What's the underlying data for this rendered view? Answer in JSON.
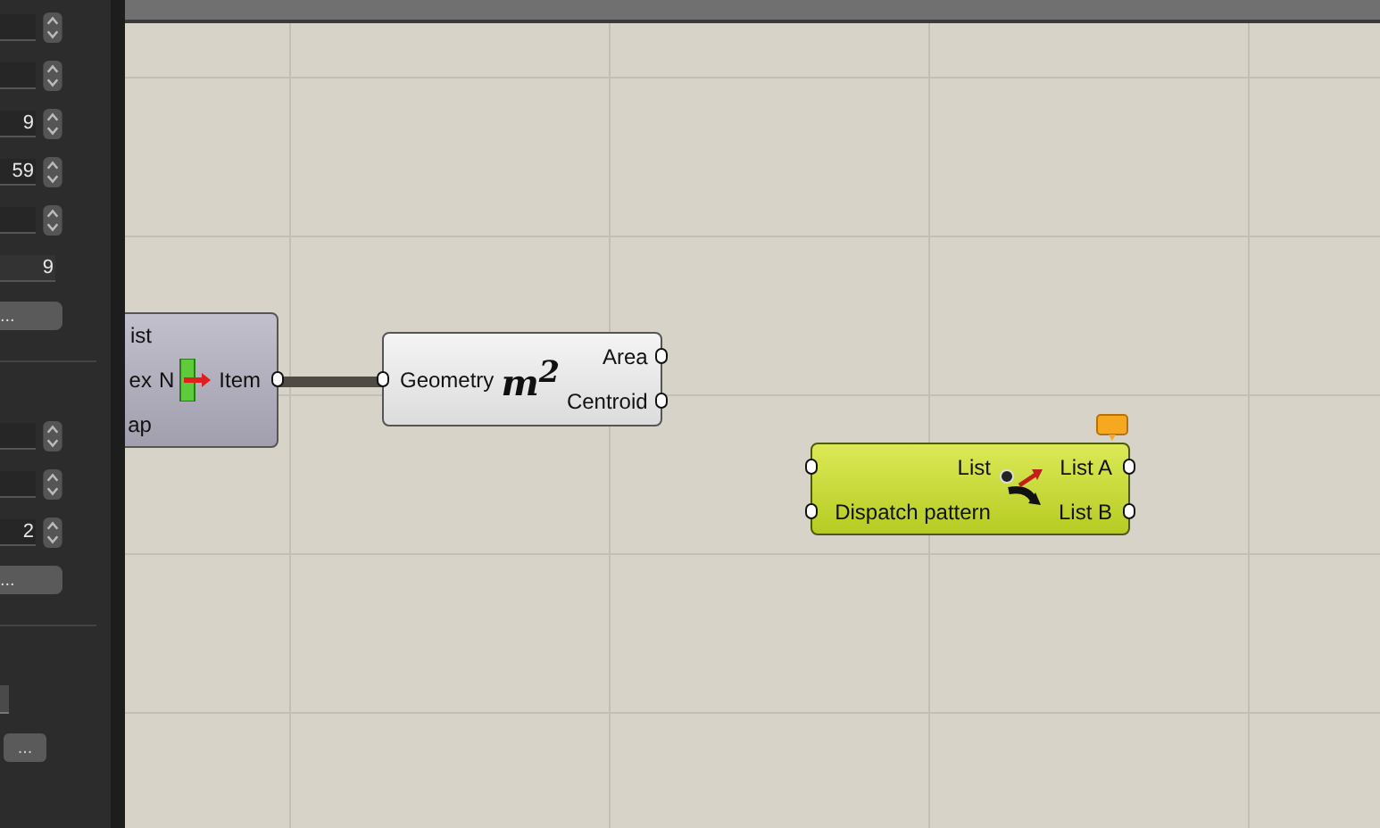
{
  "panel": {
    "groups": [
      {
        "fields": [
          {
            "kind": "spin"
          },
          {
            "kind": "spin"
          },
          {
            "kind": "spin",
            "value": "9"
          },
          {
            "kind": "spin",
            "value": "59"
          },
          {
            "kind": "spin"
          },
          {
            "kind": "text",
            "value": "9"
          },
          {
            "kind": "button",
            "value": "..."
          }
        ]
      },
      {
        "fields": [
          {
            "kind": "spin"
          },
          {
            "kind": "spin"
          },
          {
            "kind": "spin",
            "value": "2"
          },
          {
            "kind": "button",
            "value": "..."
          }
        ]
      },
      {
        "fields": [
          {
            "kind": "stub"
          },
          {
            "kind": "small_button",
            "value": "..."
          }
        ]
      }
    ]
  },
  "nodes": [
    {
      "kind": "list_item",
      "inputs": [
        "ist",
        "ex",
        "ap"
      ],
      "symbol": "N",
      "outputs": [
        "Item"
      ]
    },
    {
      "kind": "area",
      "inputs": [
        "Geometry"
      ],
      "symbol": "m$^{2}$",
      "outputs": [
        "Area",
        "Centroid"
      ]
    },
    {
      "kind": "dispatch",
      "inputs": [
        "List",
        "Dispatch pattern"
      ],
      "outputs": [
        "List A",
        "List B"
      ],
      "message": true
    }
  ]
}
